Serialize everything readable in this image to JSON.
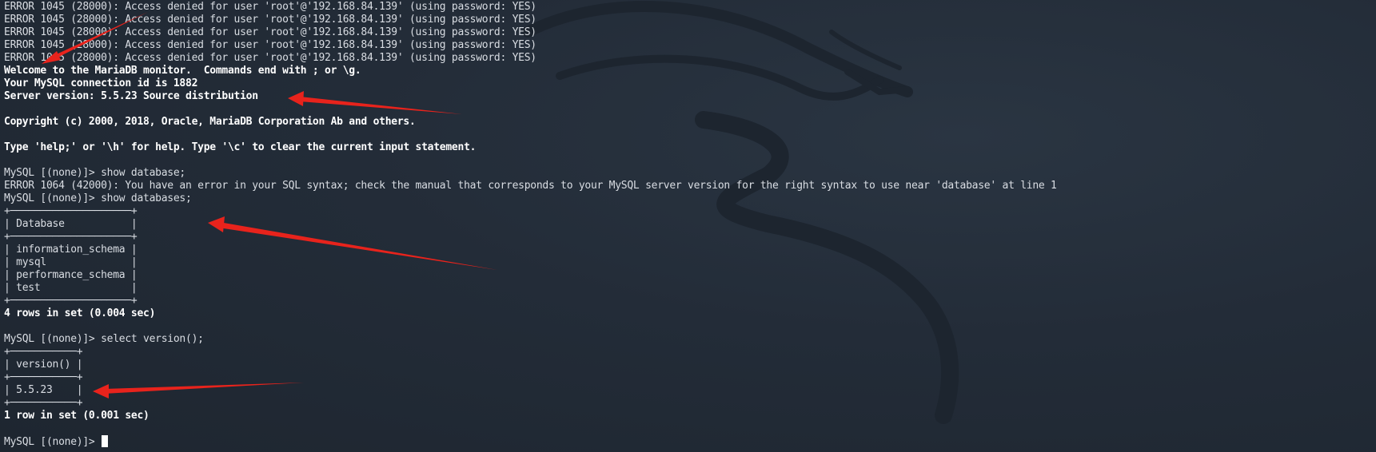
{
  "terminal": {
    "lines": [
      {
        "text": "ERROR 1045 (28000): Access denied for user 'root'@'192.168.84.139' (using password: YES)",
        "style": "normal"
      },
      {
        "text": "ERROR 1045 (28000): Access denied for user 'root'@'192.168.84.139' (using password: YES)",
        "style": "normal"
      },
      {
        "text": "ERROR 1045 (28000): Access denied for user 'root'@'192.168.84.139' (using password: YES)",
        "style": "normal"
      },
      {
        "text": "ERROR 1045 (28000): Access denied for user 'root'@'192.168.84.139' (using password: YES)",
        "style": "normal"
      },
      {
        "text": "ERROR 1045 (28000): Access denied for user 'root'@'192.168.84.139' (using password: YES)",
        "style": "normal"
      },
      {
        "text": "Welcome to the MariaDB monitor.  Commands end with ; or \\g.",
        "style": "bold"
      },
      {
        "text": "Your MySQL connection id is 1882",
        "style": "bold"
      },
      {
        "text": "Server version: 5.5.23 Source distribution",
        "style": "bold"
      },
      {
        "text": "",
        "style": "normal"
      },
      {
        "text": "Copyright (c) 2000, 2018, Oracle, MariaDB Corporation Ab and others.",
        "style": "bold"
      },
      {
        "text": "",
        "style": "normal"
      },
      {
        "text": "Type 'help;' or '\\h' for help. Type '\\c' to clear the current input statement.",
        "style": "bold"
      },
      {
        "text": "",
        "style": "normal"
      },
      {
        "text": "MySQL [(none)]> show database;",
        "style": "normal"
      },
      {
        "text": "ERROR 1064 (42000): You have an error in your SQL syntax; check the manual that corresponds to your MySQL server version for the right syntax to use near 'database' at line 1",
        "style": "normal"
      },
      {
        "text": "MySQL [(none)]> show databases;",
        "style": "normal"
      },
      {
        "text": "+────────────────────+",
        "style": "normal"
      },
      {
        "text": "| Database           |",
        "style": "normal"
      },
      {
        "text": "+────────────────────+",
        "style": "normal"
      },
      {
        "text": "| information_schema |",
        "style": "normal"
      },
      {
        "text": "| mysql              |",
        "style": "normal"
      },
      {
        "text": "| performance_schema |",
        "style": "normal"
      },
      {
        "text": "| test               |",
        "style": "normal"
      },
      {
        "text": "+────────────────────+",
        "style": "normal"
      },
      {
        "text": "4 rows in set (0.004 sec)",
        "style": "bold"
      },
      {
        "text": "",
        "style": "normal"
      },
      {
        "text": "MySQL [(none)]> select version();",
        "style": "normal"
      },
      {
        "text": "+───────────+",
        "style": "normal"
      },
      {
        "text": "| version() |",
        "style": "normal"
      },
      {
        "text": "+───────────+",
        "style": "normal"
      },
      {
        "text": "| 5.5.23    |",
        "style": "normal"
      },
      {
        "text": "+───────────+",
        "style": "normal"
      },
      {
        "text": "1 row in set (0.001 sec)",
        "style": "bold"
      },
      {
        "text": "",
        "style": "normal"
      }
    ],
    "prompt": "MySQL [(none)]> "
  },
  "colors": {
    "background": "#232c38",
    "text": "#d9dde3",
    "bold_text": "#ffffff",
    "annotation_arrow": "#e8231c"
  }
}
